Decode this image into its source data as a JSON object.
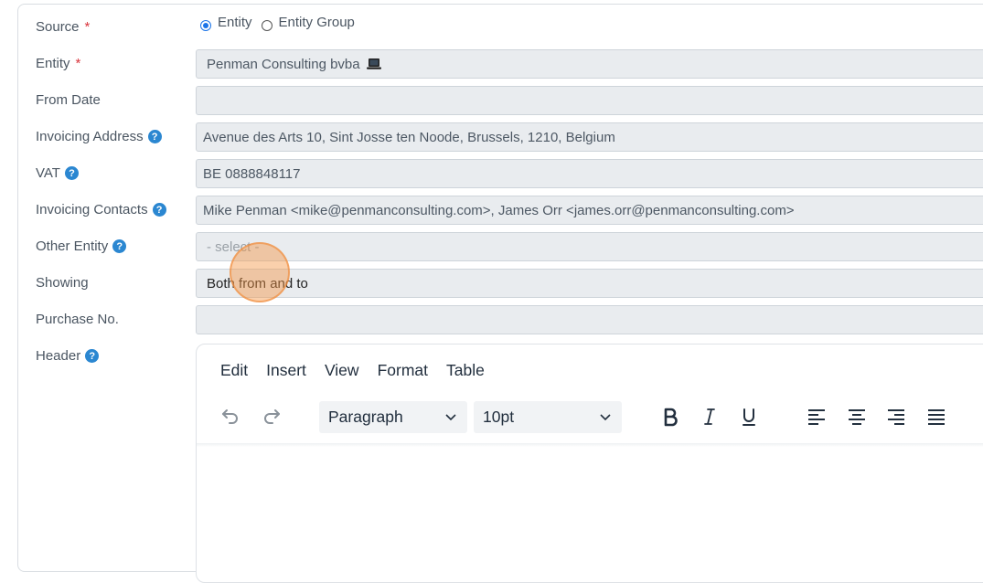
{
  "form": {
    "source": {
      "label": "Source",
      "required_mark": "*",
      "options": [
        "Entity",
        "Entity Group"
      ],
      "selected": "Entity"
    },
    "entity": {
      "label": "Entity",
      "required_mark": "*",
      "value": "Penman Consulting bvba",
      "icon": "laptop-icon"
    },
    "from_date": {
      "label": "From Date",
      "value": ""
    },
    "invoicing_address": {
      "label": "Invoicing Address",
      "value": "Avenue des Arts 10, Sint Josse ten Noode, Brussels, 1210, Belgium"
    },
    "vat": {
      "label": "VAT",
      "value": "BE 0888848117"
    },
    "invoicing_contacts": {
      "label": "Invoicing Contacts",
      "value": "Mike Penman <mike@penmanconsulting.com>, James Orr <james.orr@penmanconsulting.com>"
    },
    "other_entity": {
      "label": "Other Entity",
      "placeholder": "- select -"
    },
    "showing": {
      "label": "Showing",
      "value": "Both from and to"
    },
    "purchase_no": {
      "label": "Purchase No.",
      "value": ""
    },
    "header": {
      "label": "Header"
    },
    "help_glyph": "?"
  },
  "editor": {
    "menu": [
      "Edit",
      "Insert",
      "View",
      "Format",
      "Table"
    ],
    "block_format": "Paragraph",
    "font_size": "10pt",
    "tools": [
      "undo-icon",
      "redo-icon",
      "bold-icon",
      "italic-icon",
      "underline-icon",
      "align-left-icon",
      "align-center-icon",
      "align-right-icon",
      "align-justify-icon"
    ]
  },
  "colors": {
    "accent": "#2b87d1",
    "required": "#d9363e",
    "cursor_highlight": "#f59646"
  }
}
